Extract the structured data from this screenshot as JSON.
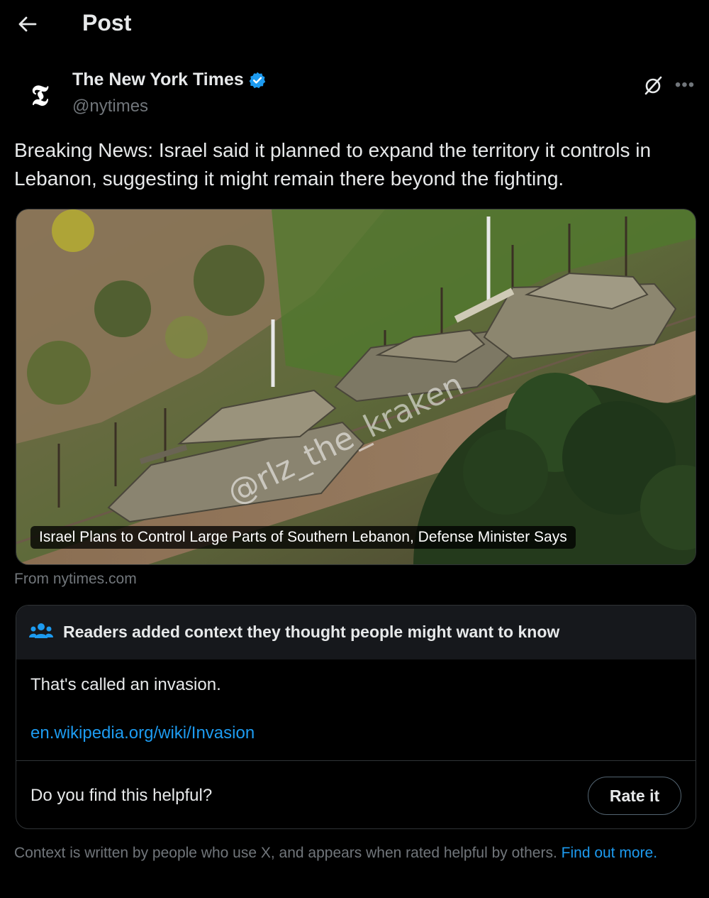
{
  "header": {
    "title": "Post",
    "back_icon": "arrow-left-icon"
  },
  "author": {
    "name": "The New York Times",
    "handle": "@nytimes",
    "avatar_glyph": "𝕿",
    "verified_icon": "verified-badge-icon",
    "verified_color": "#1d9bf0"
  },
  "post": {
    "text": "Breaking News: Israel said it planned to expand the territory it controls in Lebanon, suggesting it might remain there beyond the fighting."
  },
  "media": {
    "caption": "Israel Plans to Control Large Parts of Southern Lebanon, Defense Minister Says",
    "watermark": "@rlz_the_kraken",
    "source": "From nytimes.com"
  },
  "community_note": {
    "header": "Readers added context they thought people might want to know",
    "body": "That's called an invasion.",
    "link": "en.wikipedia.org/wiki/Invasion",
    "question": "Do you find this helpful?",
    "rate_label": "Rate it"
  },
  "footer": {
    "text": "Context is written by people who use X, and appears when rated helpful by others. ",
    "link": "Find out more."
  },
  "colors": {
    "background": "#000000",
    "text": "#e7e9ea",
    "secondary": "#71767b",
    "accent": "#1d9bf0",
    "border": "#2f3336"
  }
}
